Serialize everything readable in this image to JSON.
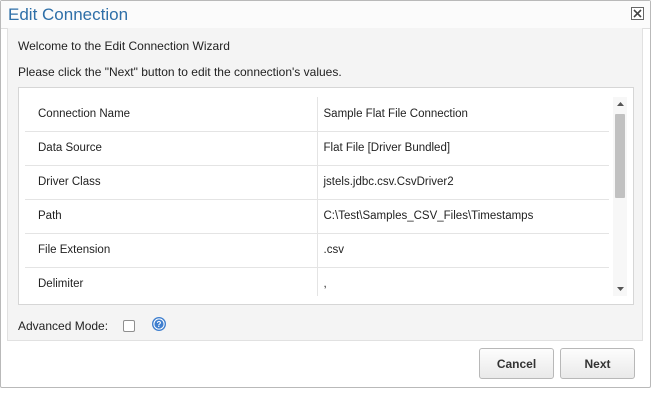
{
  "dialog": {
    "title": "Edit Connection",
    "close_icon": "close-icon"
  },
  "intro": {
    "welcome": "Welcome to the Edit Connection Wizard",
    "instructions": "Please click the \"Next\" button to edit the connection's values."
  },
  "properties": [
    {
      "key": "Connection Name",
      "value": "Sample Flat File Connection"
    },
    {
      "key": "Data Source",
      "value": "Flat File [Driver Bundled]"
    },
    {
      "key": "Driver Class",
      "value": "jstels.jdbc.csv.CsvDriver2"
    },
    {
      "key": "Path",
      "value": "C:\\Test\\Samples_CSV_Files\\Timestamps"
    },
    {
      "key": "File Extension",
      "value": ".csv"
    },
    {
      "key": "Delimiter",
      "value": ","
    }
  ],
  "advanced": {
    "label": "Advanced Mode:",
    "checked": false,
    "help_icon": "help-icon"
  },
  "buttons": {
    "cancel": "Cancel",
    "next": "Next"
  },
  "colors": {
    "title": "#2e6fa8",
    "help_icon": "#3f7fcf"
  }
}
